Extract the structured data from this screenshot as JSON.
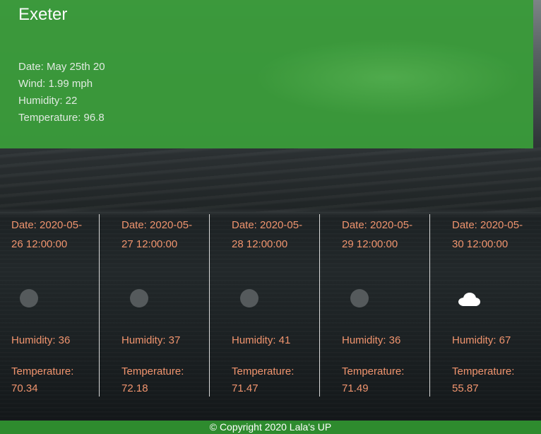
{
  "current": {
    "city": "Exeter",
    "date": "Date: May 25th 20",
    "wind": "Wind: 1.99 mph",
    "humidity": "Humidity: 22",
    "temperature": "Temperature: 96.8"
  },
  "forecast": [
    {
      "date": "Date: 2020-05-26 12:00:00",
      "icon": "moon-icon",
      "humidity": "Humidity: 36",
      "temp_label": "Temperature:",
      "temp_value": "70.34"
    },
    {
      "date": "Date: 2020-05-27 12:00:00",
      "icon": "moon-icon",
      "humidity": "Humidity: 37",
      "temp_label": "Temperature:",
      "temp_value": "72.18"
    },
    {
      "date": "Date: 2020-05-28 12:00:00",
      "icon": "moon-icon",
      "humidity": "Humidity: 41",
      "temp_label": "Temperature:",
      "temp_value": "71.47"
    },
    {
      "date": "Date: 2020-05-29 12:00:00",
      "icon": "moon-icon",
      "humidity": "Humidity: 36",
      "temp_label": "Temperature:",
      "temp_value": "71.49"
    },
    {
      "date": "Date: 2020-05-30 12:00:00",
      "icon": "cloud-icon",
      "humidity": "Humidity: 67",
      "temp_label": "Temperature:",
      "temp_value": "55.87"
    }
  ],
  "footer": {
    "text": "© Copyright 2020 Lala's UP"
  },
  "colors": {
    "current_panel": "#3a9a3a",
    "forecast_text": "#f0946e",
    "footer": "#2e8b2e"
  }
}
